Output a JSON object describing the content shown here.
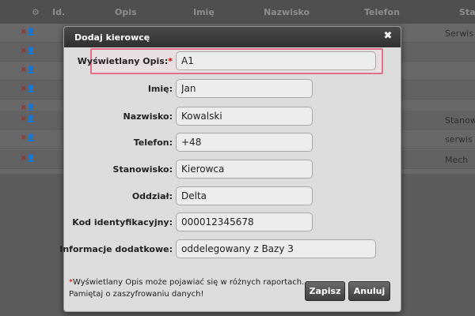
{
  "background": {
    "columns": [
      "Id.",
      "Opis",
      "Imię",
      "Nazwisko",
      "Telefon",
      "Sta"
    ],
    "rows": [
      {
        "cell": "Serwis"
      },
      {
        "cell": ""
      },
      {
        "cell": ""
      },
      {
        "cell": ""
      },
      {
        "cell": ""
      },
      {
        "cell": "Stanow"
      },
      {
        "cell": "serwis"
      },
      {
        "cell": "Mech"
      }
    ]
  },
  "modal": {
    "title": "Dodaj kierowcę",
    "fields": [
      {
        "label": "Wyświetlany Opis:",
        "required_mark": "*",
        "value": "A1"
      },
      {
        "label": "Imię:",
        "value": "Jan"
      },
      {
        "label": "Nazwisko:",
        "value": "Kowalski"
      },
      {
        "label": "Telefon:",
        "value": "+48"
      },
      {
        "label": "Stanowisko:",
        "value": "Kierowca"
      },
      {
        "label": "Oddział:",
        "value": "Delta"
      },
      {
        "label": "Kod identyfikacyjny:",
        "value": "000012345678"
      },
      {
        "label": "Informacje dodatkowe:",
        "value": "oddelegowany z Bazy 3"
      }
    ],
    "footnote_mark": "*",
    "footnote_line1": "Wyświetlany Opis może pojawiać się w różnych raportach.",
    "footnote_line2": "Pamiętaj o zaszyfrowaniu danych!",
    "save_label": "Zapisz",
    "cancel_label": "Anuluj"
  },
  "colors": {
    "highlight_border": "#e0708a",
    "required": "#cc0000",
    "header": "#2f2f2f"
  }
}
